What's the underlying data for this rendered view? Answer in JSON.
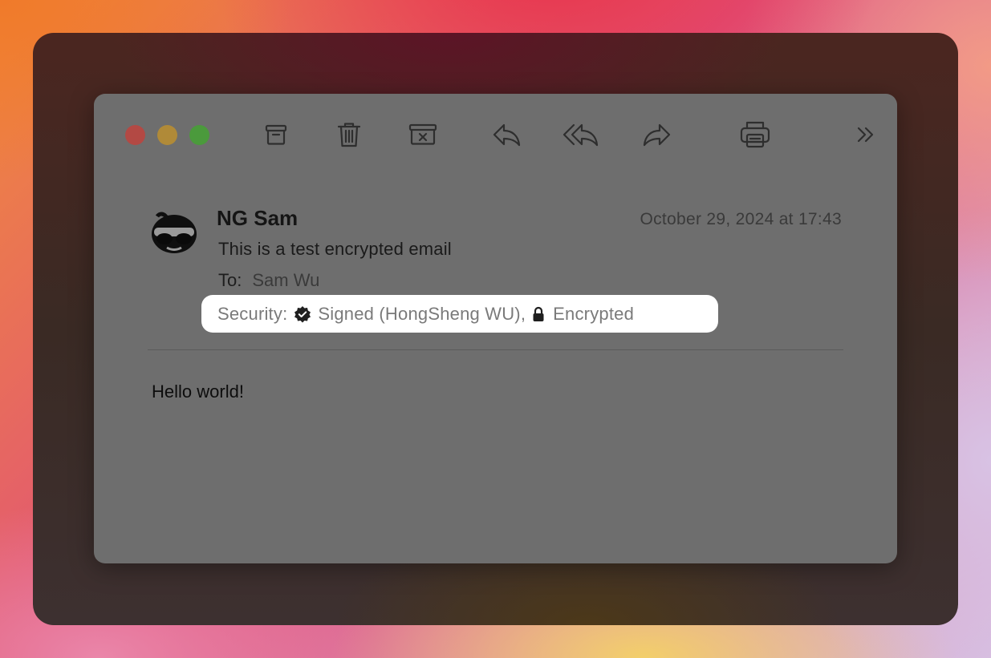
{
  "window": {
    "traffic_lights": {
      "close_color": "#b34944",
      "minimize_color": "#b08a38",
      "zoom_color": "#4b9a3c"
    }
  },
  "toolbar": {
    "icons": [
      "archive-icon",
      "trash-icon",
      "junk-icon",
      "reply-icon",
      "reply-all-icon",
      "forward-icon",
      "print-icon",
      "more-chevron-icon"
    ]
  },
  "message": {
    "sender": "NG Sam",
    "date": "October 29, 2024 at 17:43",
    "subject": "This is a test encrypted email",
    "to_label": "To:",
    "to_value": "Sam Wu",
    "security": {
      "label": "Security:",
      "signed_text": "Signed (HongSheng WU),",
      "encrypted_text": "Encrypted",
      "signed_icon": "verified-badge-icon",
      "encrypted_icon": "lock-icon",
      "highlight_color": "#ffffff"
    },
    "body": "Hello world!"
  }
}
